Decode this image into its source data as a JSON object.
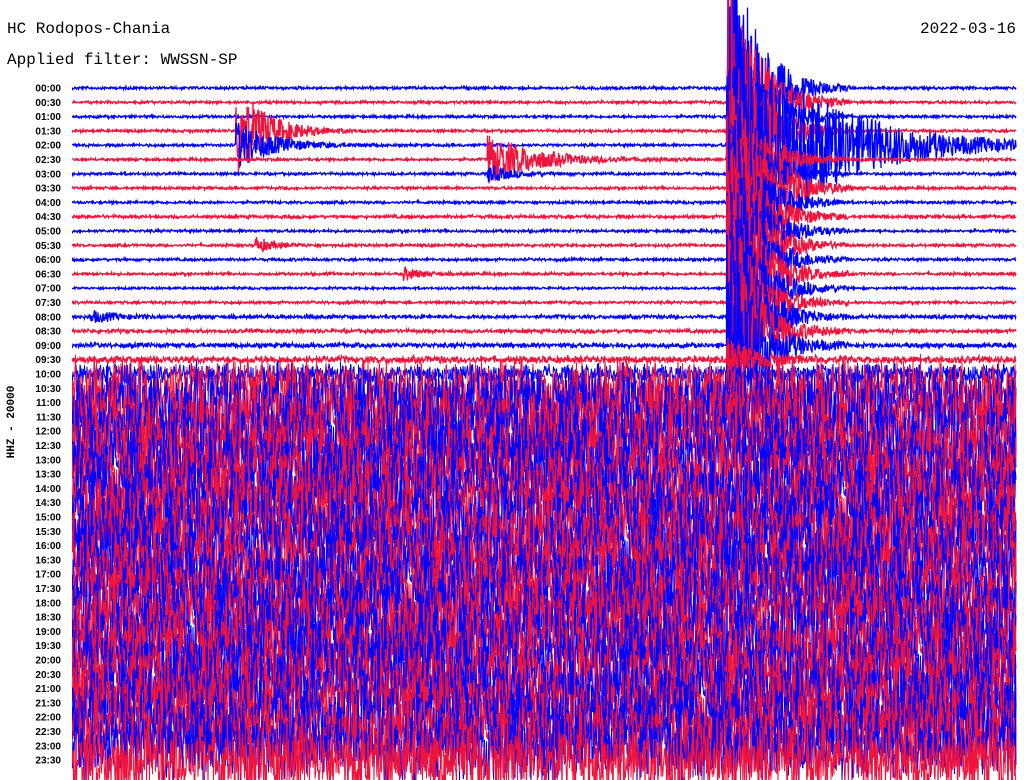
{
  "header": {
    "station": "HC Rodopos-Chania",
    "filter": "Applied filter: WWSSN-SP",
    "date": "2022-03-16"
  },
  "chart_data": {
    "type": "line",
    "title": "HC Rodopos-Chania",
    "subtitle": "Applied filter: WWSSN-SP",
    "ylabel": "HHZ - 20000",
    "xlabel": "",
    "minutes_per_row": 30,
    "row_labels": [
      "00:00",
      "00:30",
      "01:00",
      "01:30",
      "02:00",
      "02:30",
      "03:00",
      "03:30",
      "04:00",
      "04:30",
      "05:00",
      "05:30",
      "06:00",
      "06:30",
      "07:00",
      "07:30",
      "08:00",
      "08:30",
      "09:00",
      "09:30",
      "10:00",
      "10:30",
      "11:00",
      "11:30",
      "12:00",
      "12:30",
      "13:00",
      "13:30",
      "14:00",
      "14:30",
      "15:00",
      "15:30",
      "16:00",
      "16:30",
      "17:00",
      "17:30",
      "18:00",
      "18:30",
      "19:00",
      "19:30",
      "20:00",
      "20:30",
      "21:00",
      "21:30",
      "22:00",
      "22:30",
      "23:00",
      "23:30"
    ],
    "series_colors": [
      "#0000ff",
      "#f0143c"
    ],
    "noise_amplitude": [
      0.12,
      0.12,
      0.12,
      0.12,
      0.12,
      0.12,
      0.12,
      0.12,
      0.12,
      0.14,
      0.12,
      0.12,
      0.12,
      0.12,
      0.1,
      0.12,
      0.16,
      0.16,
      0.2,
      0.3,
      0.8,
      2.5,
      3,
      3,
      3,
      3,
      3,
      3,
      3,
      3,
      3,
      3,
      3,
      3,
      3,
      3,
      3,
      3,
      3,
      3,
      3,
      3,
      3,
      3,
      3,
      3,
      3,
      3
    ],
    "events": [
      {
        "row": 0,
        "minute": 20.8,
        "amplitude": 12,
        "duration": 1.3
      },
      {
        "row": 1,
        "minute": 20.8,
        "amplitude": 12,
        "duration": 1.3
      },
      {
        "row": 2,
        "minute": 20.8,
        "amplitude": 12,
        "duration": 1.3
      },
      {
        "row": 3,
        "minute": 20.8,
        "amplitude": 12,
        "duration": 1.3
      },
      {
        "row": 4,
        "minute": 20.8,
        "amplitude": 10,
        "duration": 4
      },
      {
        "row": 5,
        "minute": 20.8,
        "amplitude": 8,
        "duration": 1.3
      },
      {
        "row": 6,
        "minute": 20.8,
        "amplitude": 8,
        "duration": 1.3
      },
      {
        "row": 7,
        "minute": 20.8,
        "amplitude": 8,
        "duration": 1.3
      },
      {
        "row": 8,
        "minute": 20.8,
        "amplitude": 8,
        "duration": 1.3
      },
      {
        "row": 9,
        "minute": 20.8,
        "amplitude": 8,
        "duration": 1.3
      },
      {
        "row": 10,
        "minute": 20.8,
        "amplitude": 8,
        "duration": 1.3
      },
      {
        "row": 11,
        "minute": 20.8,
        "amplitude": 8,
        "duration": 1.3
      },
      {
        "row": 12,
        "minute": 20.8,
        "amplitude": 8,
        "duration": 1.3
      },
      {
        "row": 13,
        "minute": 20.8,
        "amplitude": 8,
        "duration": 1.3
      },
      {
        "row": 14,
        "minute": 20.8,
        "amplitude": 8,
        "duration": 1.3
      },
      {
        "row": 15,
        "minute": 20.8,
        "amplitude": 8,
        "duration": 1.3
      },
      {
        "row": 16,
        "minute": 20.8,
        "amplitude": 8,
        "duration": 1.3
      },
      {
        "row": 17,
        "minute": 20.8,
        "amplitude": 8,
        "duration": 1.3
      },
      {
        "row": 18,
        "minute": 20.8,
        "amplitude": 8,
        "duration": 1.3
      },
      {
        "row": 19,
        "minute": 20.8,
        "amplitude": 1.5,
        "duration": 1.3
      },
      {
        "row": 3,
        "minute": 5.2,
        "amplitude": 3.5,
        "duration": 1.4
      },
      {
        "row": 4,
        "minute": 5.2,
        "amplitude": 1.8,
        "duration": 1.6
      },
      {
        "row": 5,
        "minute": 13.2,
        "amplitude": 1.8,
        "duration": 2.2
      },
      {
        "row": 6,
        "minute": 13.2,
        "amplitude": 0.6,
        "duration": 1.2
      },
      {
        "row": 7,
        "minute": 22.7,
        "amplitude": 0.8,
        "duration": 1.2
      },
      {
        "row": 11,
        "minute": 5.8,
        "amplitude": 0.6,
        "duration": 0.8
      },
      {
        "row": 13,
        "minute": 10.5,
        "amplitude": 0.5,
        "duration": 0.8
      },
      {
        "row": 13,
        "minute": 21,
        "amplitude": 0.4,
        "duration": 1.5
      },
      {
        "row": 16,
        "minute": 0.6,
        "amplitude": 0.4,
        "duration": 1.2
      }
    ]
  }
}
